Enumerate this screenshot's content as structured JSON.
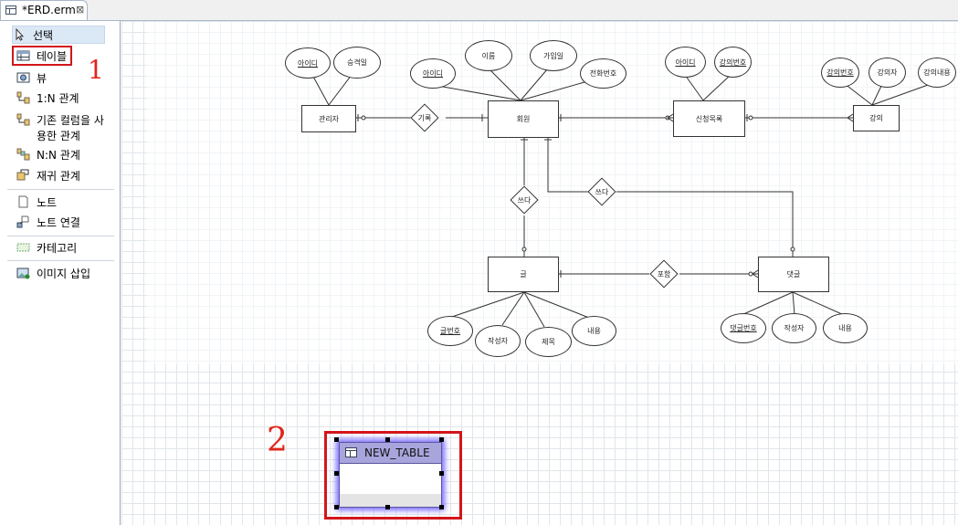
{
  "tab": {
    "title": "*ERD.erm",
    "close": "⊠"
  },
  "palette": {
    "items": [
      {
        "label": "선택",
        "icon": "pointer-icon"
      },
      {
        "label": "테이블",
        "icon": "table-icon"
      },
      {
        "label": "뷰",
        "icon": "view-icon"
      },
      {
        "label": "1:N 관계",
        "icon": "one-to-many-icon"
      },
      {
        "label": "기존 컬럼을 사\n용한 관계",
        "line1": "기존 컬럼을 사",
        "line2": "용한 관계",
        "icon": "existing-column-relation-icon"
      },
      {
        "label": "N:N 관계",
        "icon": "many-to-many-icon"
      },
      {
        "label": "재귀 관계",
        "icon": "recursive-relation-icon"
      },
      {
        "label": "노트",
        "icon": "note-icon"
      },
      {
        "label": "노트 연결",
        "icon": "note-connection-icon"
      },
      {
        "label": "카테고리",
        "icon": "category-icon"
      },
      {
        "label": "이미지 삽입",
        "icon": "insert-image-icon"
      }
    ]
  },
  "diagram": {
    "entities": {
      "admin": "관리자",
      "member": "회원",
      "enrollment": "신청목록",
      "lecture": "강의",
      "post": "글",
      "comment": "댓글"
    },
    "relations": {
      "record": "기록",
      "write1": "쓰다",
      "write2": "쓰다",
      "include": "포함"
    },
    "attributes": {
      "admin_id": "아이디",
      "admin_approve": "승격일",
      "member_id": "아이디",
      "member_name": "이름",
      "member_join": "가입일",
      "member_phone": "전화번호",
      "enroll_id": "아이디",
      "enroll_lecture_no": "강의번호",
      "lecture_no": "강의번호",
      "lecture_teacher": "강의자",
      "lecture_content": "강의내용",
      "post_no": "글번호",
      "post_author": "작성자",
      "post_title": "제목",
      "post_content": "내용",
      "comment_no": "댓글번호",
      "comment_author": "작성자",
      "comment_content": "내용"
    }
  },
  "new_table": {
    "title": "NEW_TABLE"
  },
  "annotations": {
    "step1": "1",
    "step2": "2"
  },
  "colors": {
    "highlight": "#d2161b",
    "selection_glow": "#7a6cff",
    "table_header": "#a8a4dc"
  }
}
